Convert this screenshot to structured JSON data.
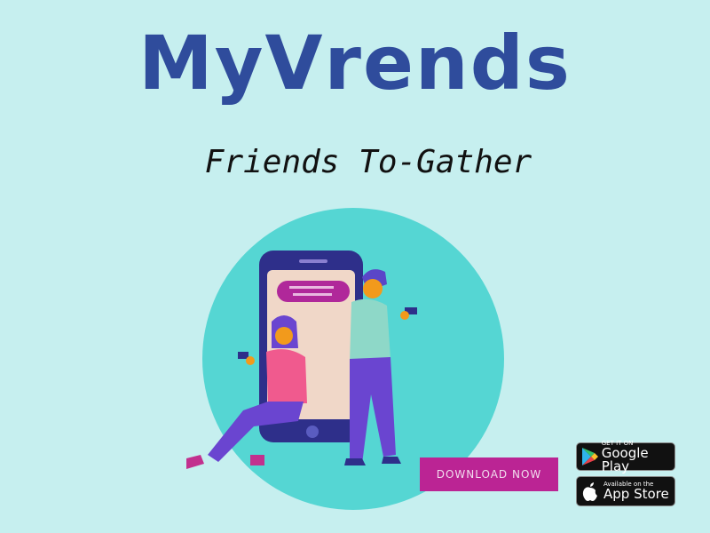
{
  "header": {
    "title": "MyVrends",
    "tagline": "Friends To-Gather"
  },
  "cta": {
    "download_label": "DOWNLOAD NOW"
  },
  "stores": {
    "google": {
      "small": "GET IT ON",
      "big": "Google Play"
    },
    "apple": {
      "small": "Available on the",
      "big": "App Store"
    }
  },
  "colors": {
    "background": "#c6efef",
    "title": "#2f4c9c",
    "circle": "#55d6d3",
    "button": "#bb2494",
    "phone": "#2e2f8a"
  }
}
